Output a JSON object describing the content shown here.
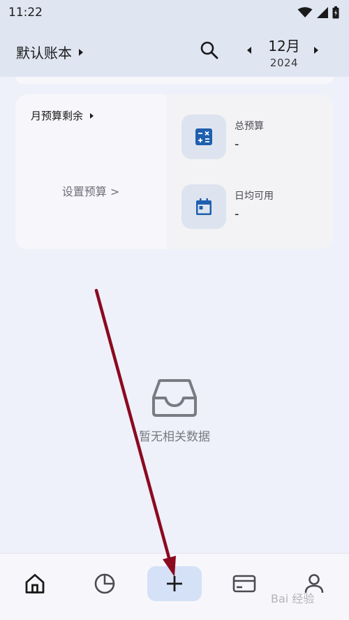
{
  "status_bar": {
    "time": "11:22",
    "icons": [
      "wifi-icon",
      "signal-icon",
      "battery-icon"
    ]
  },
  "header": {
    "book_title": "默认账本",
    "month": "12月",
    "year": "2024"
  },
  "budget_card": {
    "remaining_label": "月预算剩余",
    "set_budget_link": "设置预算 >",
    "total_budget_label": "总预算",
    "total_budget_value": "-",
    "daily_available_label": "日均可用",
    "daily_available_value": "-"
  },
  "empty_state": {
    "text": "暂无相关数据"
  },
  "bottom_nav": {
    "items": [
      "home-icon",
      "pie-chart-icon",
      "plus-icon",
      "card-icon",
      "profile-icon"
    ]
  },
  "annotation": {
    "arrow_color": "#8b0a1f"
  },
  "watermark": {
    "text": "Bai 经验"
  },
  "colors": {
    "accent_blue": "#1f5fae",
    "icon_box": "#dde4ef",
    "add_button_bg": "#d4e1f7",
    "header_bg": "#dfe5f1",
    "page_bg": "#eef0fa"
  }
}
